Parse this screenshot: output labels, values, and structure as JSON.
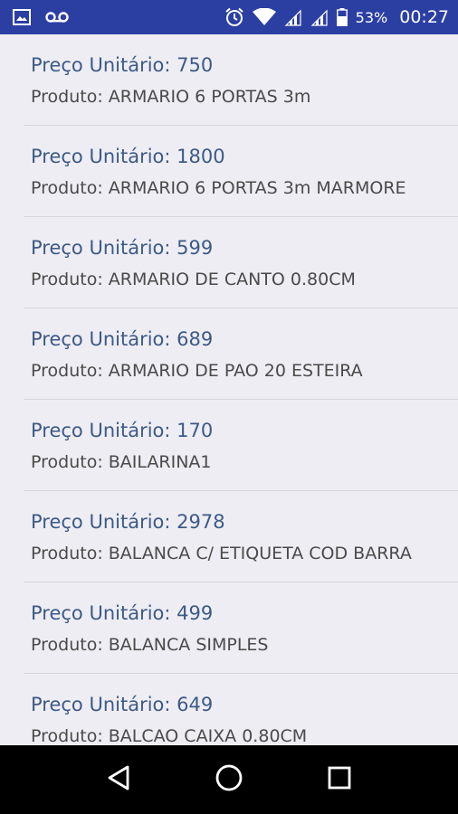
{
  "status_bar": {
    "battery_percent": "53%",
    "time": "00:27",
    "icons": [
      "image-icon",
      "voicemail-icon",
      "alarm-icon",
      "wifi-icon",
      "signal-icon",
      "signal-icon",
      "battery-icon"
    ]
  },
  "items": [
    {
      "price": "Preço Unitário: 750",
      "product": "Produto: ARMARIO 6 PORTAS 3m"
    },
    {
      "price": "Preço Unitário: 1800",
      "product": "Produto: ARMARIO 6 PORTAS 3m MARMORE"
    },
    {
      "price": "Preço Unitário: 599",
      "product": "Produto: ARMARIO DE CANTO 0.80CM"
    },
    {
      "price": "Preço Unitário: 689",
      "product": "Produto: ARMARIO DE PAO 20 ESTEIRA"
    },
    {
      "price": "Preço Unitário: 170",
      "product": "Produto: BAILARINA1"
    },
    {
      "price": "Preço Unitário: 2978",
      "product": "Produto: BALANCA C/ ETIQUETA COD BARRA"
    },
    {
      "price": "Preço Unitário: 499",
      "product": "Produto: BALANCA SIMPLES"
    },
    {
      "price": "Preço Unitário: 649",
      "product": "Produto: BALCAO CAIXA 0.80CM"
    }
  ],
  "nav_bar": {
    "icons": [
      "back-icon",
      "home-icon",
      "recents-icon"
    ]
  },
  "colors": {
    "status_bar": "#2b3fa3",
    "background": "#eeedf4",
    "price_text": "#3c5a86",
    "product_text": "#4a4a4a",
    "nav_bar": "#000000"
  }
}
